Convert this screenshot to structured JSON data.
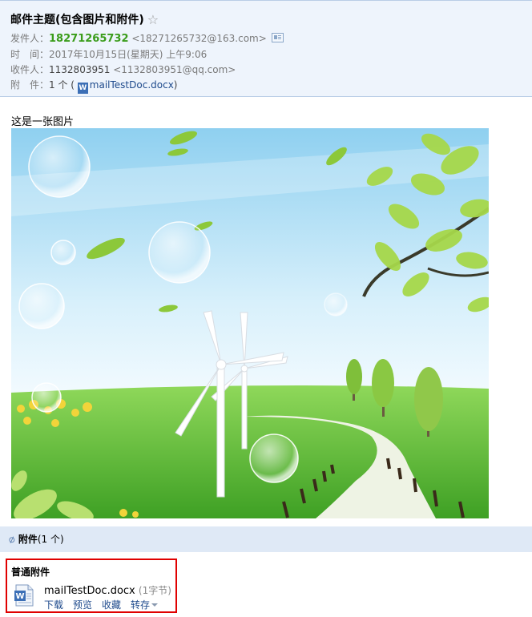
{
  "header": {
    "subject": "邮件主题(包含图片和附件)",
    "from_label": "发件人：",
    "from_name": "18271265732",
    "from_email": "<18271265732@163.com>",
    "time_label": "时　间：",
    "time_value": "2017年10月15日(星期天) 上午9:06",
    "to_label": "收件人：",
    "to_name": "1132803951",
    "to_email": "<1132803951@qq.com>",
    "attach_label": "附　件：",
    "attach_count": "1 个 (",
    "attach_file": "mailTestDoc.docx",
    "attach_close": ")"
  },
  "body": {
    "text": "这是一张图片"
  },
  "attachments": {
    "bar_title": "附件",
    "bar_count": "(1 个)",
    "section_title": "普通附件",
    "file_name": "mailTestDoc.docx",
    "file_size": "(1字节)",
    "actions": {
      "download": "下载",
      "preview": "预览",
      "favorite": "收藏",
      "save_to": "转存"
    }
  },
  "colors": {
    "header_bg": "#eef4fc",
    "sender_green": "#3a9c1a",
    "link_blue": "#1e4a8c",
    "highlight_red": "#e00000"
  }
}
